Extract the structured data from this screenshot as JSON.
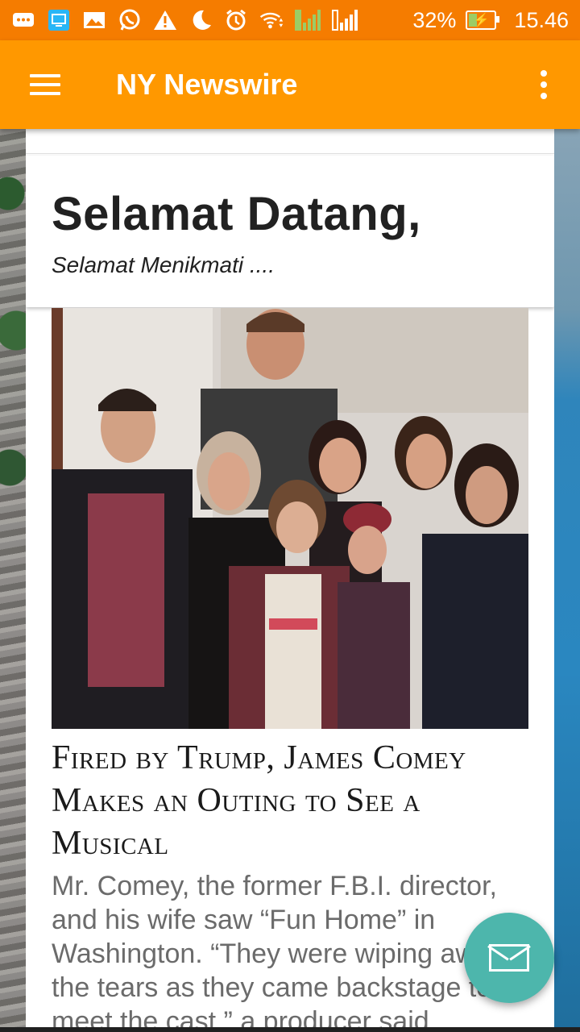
{
  "status_bar": {
    "icons": [
      "message-icon",
      "screen-cast-icon",
      "gallery-icon",
      "whatsapp-icon",
      "warning-icon",
      "moon-icon",
      "alarm-icon",
      "wifi-icon",
      "signal-icon",
      "no-signal-icon"
    ],
    "battery_percent": "32%",
    "time": "15.46"
  },
  "toolbar": {
    "title": "NY Newswire"
  },
  "welcome": {
    "title": "Selamat Datang,",
    "subtitle": "Selamat Menikmati ...."
  },
  "article": {
    "title": "Fired by Trump, James Comey Makes an Outing to See a Musical",
    "summary": "Mr. Comey, the former F.B.I. director, and his wife saw “Fun Home” in Washington. “They were wiping away the tears as they came backstage to meet the cast,” a producer said."
  },
  "colors": {
    "status_bar": "#f57c00",
    "toolbar": "#ff9800",
    "fab": "#4db6ac"
  }
}
